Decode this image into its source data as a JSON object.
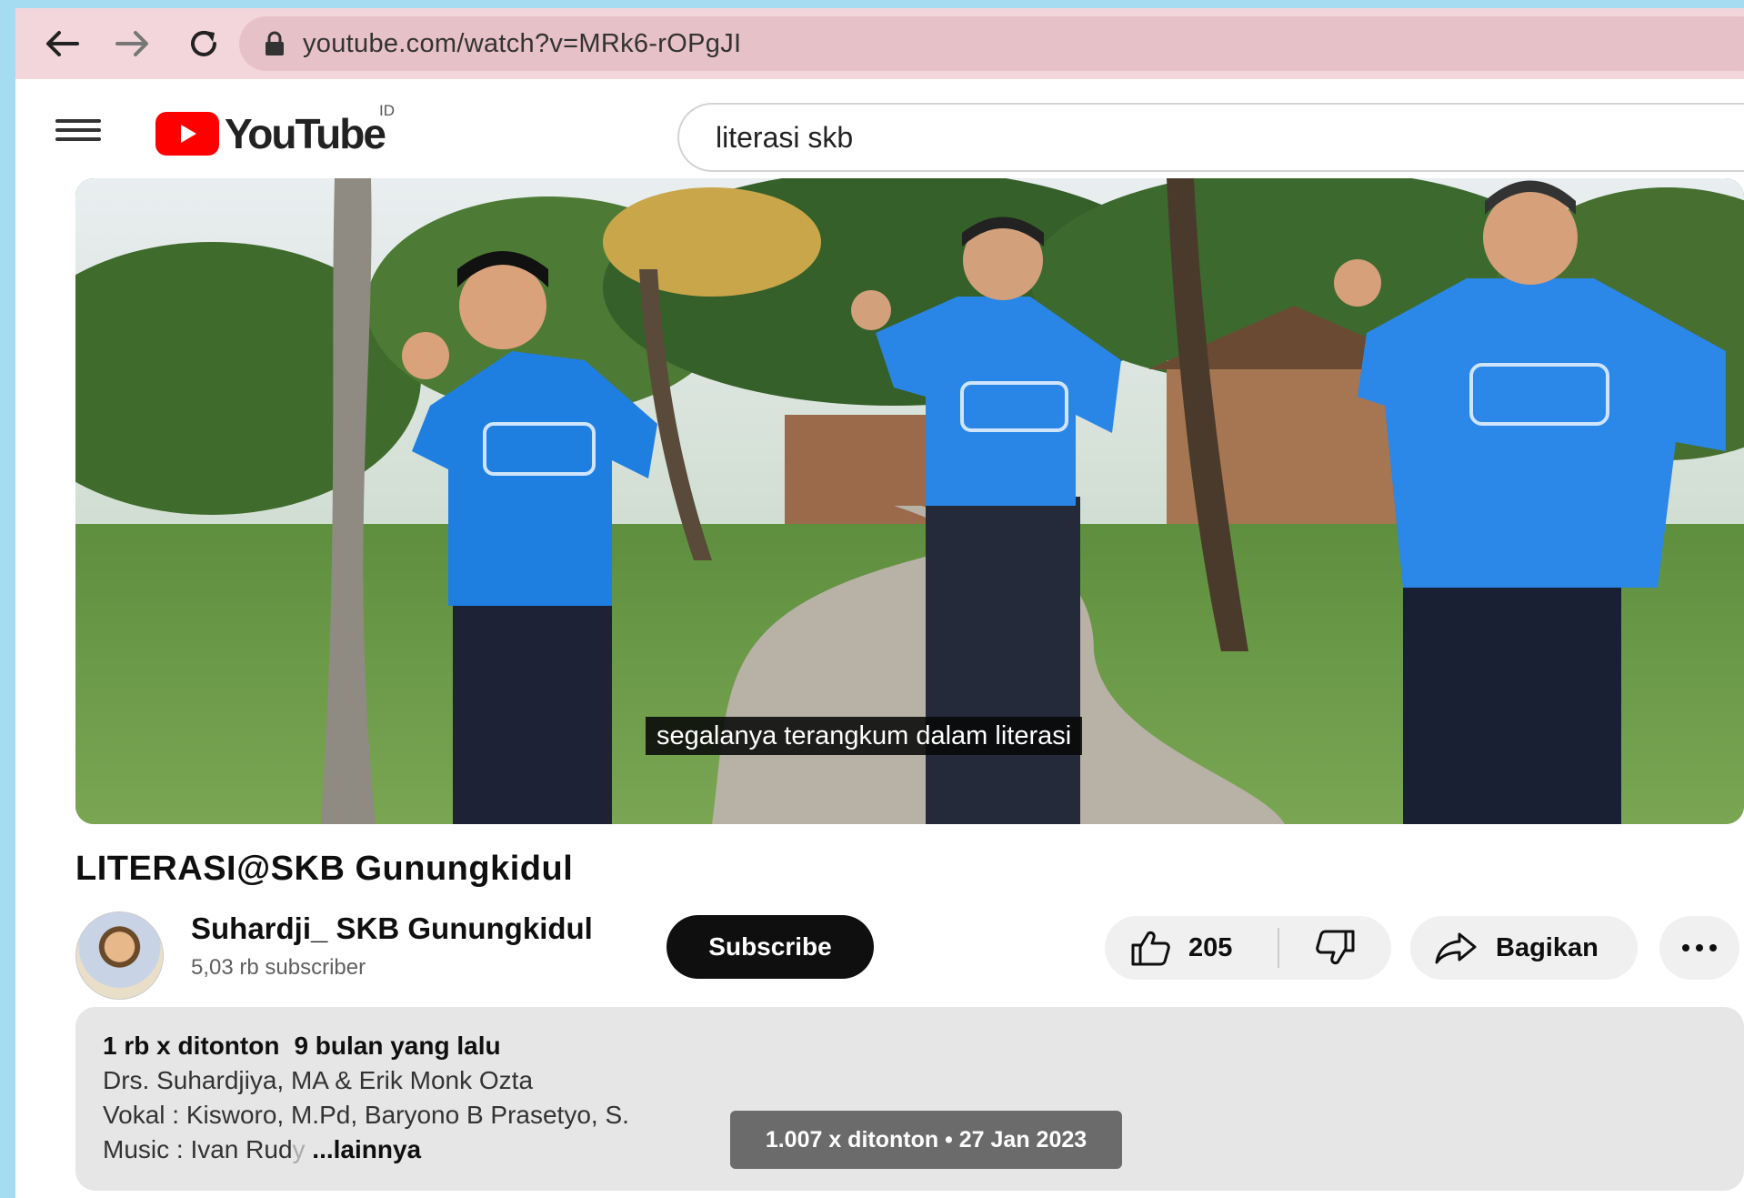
{
  "browser": {
    "url": "youtube.com/watch?v=MRk6-rOPgJI"
  },
  "header": {
    "logo_text": "YouTube",
    "region": "ID",
    "search_value": "literasi skb"
  },
  "video": {
    "subtitle": "segalanya terangkum dalam literasi",
    "title": "LITERASI@SKB Gunungkidul"
  },
  "channel": {
    "name": "Suhardji_ SKB Gunungkidul",
    "subscribers": "5,03 rb subscriber",
    "subscribe_label": "Subscribe"
  },
  "actions": {
    "likes": "205",
    "share_label": "Bagikan"
  },
  "description": {
    "views": "1 rb x ditonton",
    "age": "9 bulan yang lalu",
    "line1": "Drs. Suhardjiya, MA & Erik Monk Ozta",
    "line2": "Vokal : Kisworo, M.Pd, Baryono B Prasetyo, S.",
    "line3_prefix": "Music : Ivan Rud",
    "line3_faded": "y",
    "more_label": " ...lainnya"
  },
  "tooltip": {
    "text": "1.007 x ditonton • 27 Jan 2023"
  },
  "colors": {
    "browser_bar": "#f3d6db",
    "address_bar": "#e7c1c8",
    "youtube_red": "#ff0000",
    "subscribe_bg": "#0f0f0f",
    "page_border": "#a6dcf2"
  }
}
